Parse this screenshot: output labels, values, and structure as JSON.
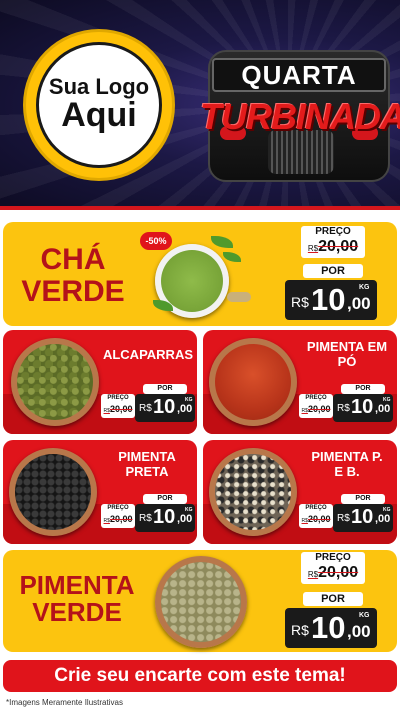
{
  "header": {
    "logo_line1": "Sua Logo",
    "logo_line2": "Aqui",
    "title_line1": "QUARTA",
    "title_line2": "TURBINADA"
  },
  "featured_top": {
    "name_line1": "CHÁ",
    "name_line2": "VERDE",
    "discount_badge": "-50%",
    "price_label": "PREÇO",
    "old_currency": "R$",
    "old_price": "20,00",
    "por_label": "POR",
    "currency": "R$",
    "price_int": "10",
    "price_dec": ",00",
    "unit": "KG"
  },
  "products": [
    {
      "name_line1": "ALCAPARRAS",
      "name_line2": "",
      "price_label": "PREÇO",
      "old_currency": "R$",
      "old_price": "20,00",
      "por_label": "POR",
      "currency": "R$",
      "price_int": "10",
      "price_dec": ",00",
      "unit": "KG"
    },
    {
      "name_line1": "PIMENTA EM",
      "name_line2": "PÓ",
      "price_label": "PREÇO",
      "old_currency": "R$",
      "old_price": "20,00",
      "por_label": "POR",
      "currency": "R$",
      "price_int": "10",
      "price_dec": ",00",
      "unit": "KG"
    },
    {
      "name_line1": "PIMENTA",
      "name_line2": "PRETA",
      "price_label": "PREÇO",
      "old_currency": "R$",
      "old_price": "20,00",
      "por_label": "POR",
      "currency": "R$",
      "price_int": "10",
      "price_dec": ",00",
      "unit": "KG"
    },
    {
      "name_line1": "PIMENTA P.",
      "name_line2": "E B.",
      "price_label": "PREÇO",
      "old_currency": "R$",
      "old_price": "20,00",
      "por_label": "POR",
      "currency": "R$",
      "price_int": "10",
      "price_dec": ",00",
      "unit": "KG"
    }
  ],
  "featured_bottom": {
    "name_line1": "PIMENTA",
    "name_line2": "VERDE",
    "price_label": "PREÇO",
    "old_currency": "R$",
    "old_price": "20,00",
    "por_label": "POR",
    "currency": "R$",
    "price_int": "10",
    "price_dec": ",00",
    "unit": "KG"
  },
  "footer": {
    "cta": "Crie seu encarte com este tema!",
    "note": "*Imagens Meramente Ilustrativas"
  },
  "colors": {
    "red": "#e0141b",
    "yellow": "#fcc40f",
    "dark_red_text": "#b4121a",
    "header_bg": "#1c1845"
  }
}
